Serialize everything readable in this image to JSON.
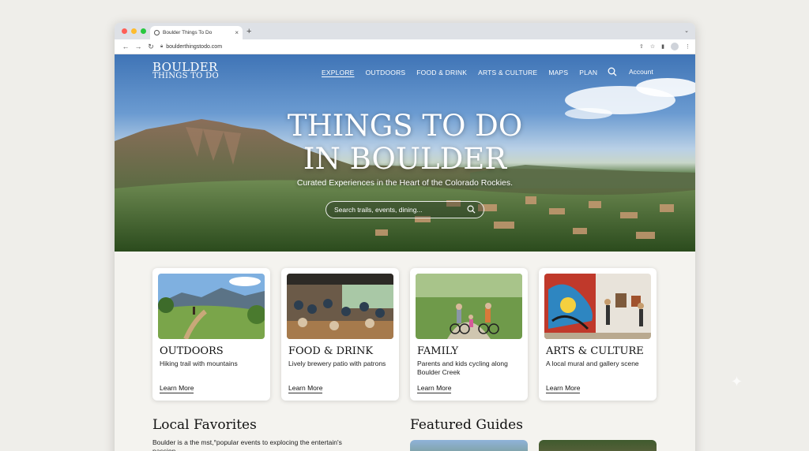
{
  "browser": {
    "tab_title": "Boulder Things To Do",
    "tab_close": "×",
    "new_tab": "+",
    "url": "boulderthingstodo.com"
  },
  "site": {
    "logo_line1": "BOULDER",
    "logo_line2": "THINGS TO DO",
    "nav": [
      "EXPLORE",
      "OUTDOORS",
      "FOOD & DRINK",
      "ARTS & CULTURE",
      "MAPS",
      "PLAN"
    ],
    "active_nav": "EXPLORE",
    "account": "Account"
  },
  "hero": {
    "title_line1": "THINGS TO DO",
    "title_line2": "IN BOULDER",
    "subtitle": "Curated Experiences in the Heart of the Colorado Rockies.",
    "search_placeholder": "Search trails, events, dining..."
  },
  "cards": [
    {
      "title": "OUTDOORS",
      "description": "Hiking trail with mountains",
      "link": "Learn More"
    },
    {
      "title": "FOOD & DRINK",
      "description": "Lively brewery patio with patrons",
      "link": "Learn More"
    },
    {
      "title": "FAMILY",
      "description": "Parents and kids cycling along Boulder Creek",
      "link": "Learn More"
    },
    {
      "title": "ARTS & CULTURE",
      "description": "A local mural and gallery scene",
      "link": "Learn More"
    }
  ],
  "sections": {
    "local_favorites_title": "Local Favorites",
    "local_favorites_text": "Boulder is a the mst,°popular events to explocing the entertain's passion",
    "featured_guides_title": "Featured Guides"
  },
  "colors": {
    "accent_window_close": "#ff5f57",
    "accent_window_min": "#febc2e",
    "accent_window_max": "#28c840"
  },
  "icons": [
    "globe-icon",
    "back-icon",
    "forward-icon",
    "reload-icon",
    "lock-icon",
    "share-icon",
    "star-icon",
    "sidepanel-icon",
    "profile-icon",
    "menu-icon",
    "search-icon"
  ]
}
